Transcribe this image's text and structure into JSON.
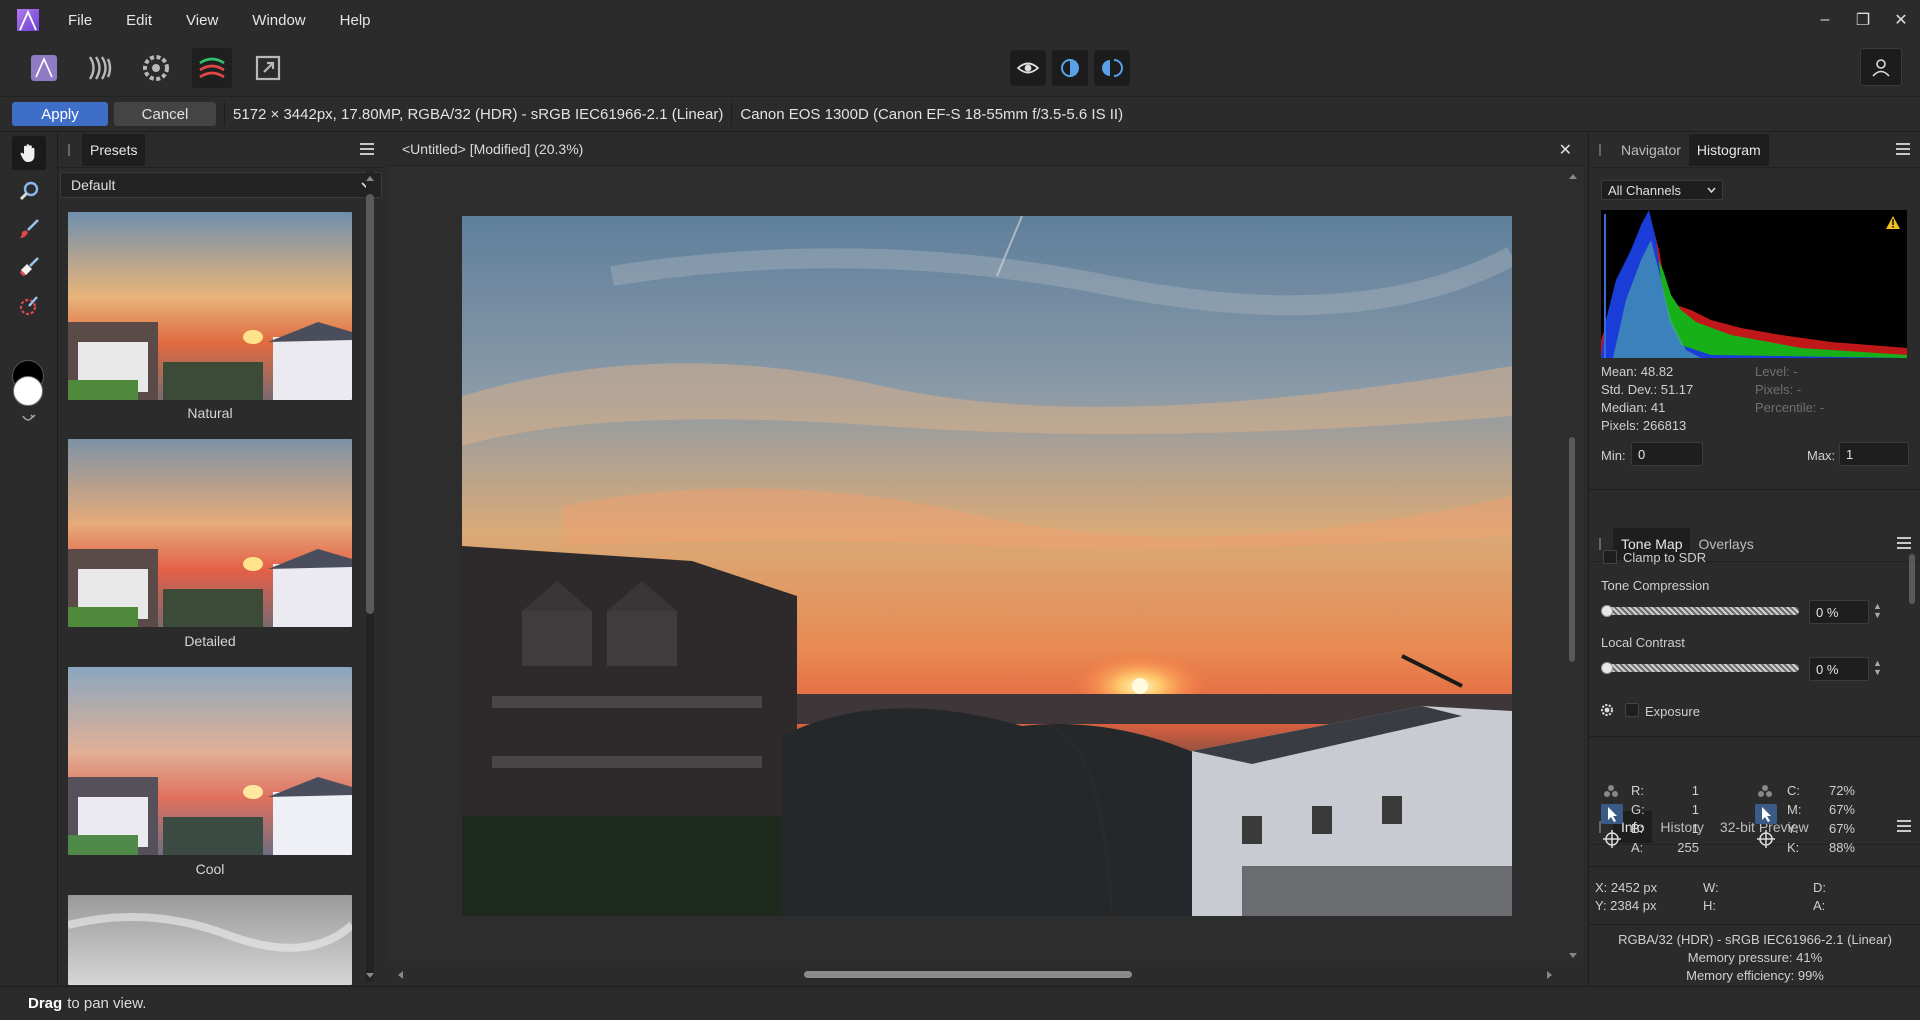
{
  "menu": {
    "items": [
      "File",
      "Edit",
      "View",
      "Window",
      "Help"
    ]
  },
  "window_controls": {
    "minimize": "–",
    "restore": "❐",
    "close": "✕"
  },
  "toolbar": {
    "personas": [
      "photo-persona",
      "liquify-persona",
      "develop-persona",
      "tone-mapping-persona",
      "export-persona"
    ],
    "active_persona": "tone-mapping-persona",
    "view_buttons": [
      "preview-icon",
      "split-view-icon",
      "mirror-view-icon"
    ]
  },
  "context_bar": {
    "apply": "Apply",
    "cancel": "Cancel",
    "image_info": "5172 × 3442px, 17.80MP, RGBA/32 (HDR) - sRGB IEC61966-2.1 (Linear)",
    "camera_info": "Canon EOS 1300D (Canon EF-S 18-55mm f/3.5-5.6 IS II)"
  },
  "presets_panel": {
    "tab": "Presets",
    "category": "Default",
    "presets": [
      "Natural",
      "Detailed",
      "Cool"
    ]
  },
  "document": {
    "title": "<Untitled> [Modified] (20.3%)"
  },
  "navigator_panel": {
    "tabs": [
      "Navigator",
      "Histogram"
    ],
    "active_tab": "Histogram",
    "channel": "All Channels",
    "stats": {
      "mean": "Mean: 48.82",
      "std_dev": "Std. Dev.: 51.17",
      "median": "Median: 41",
      "pixels": "Pixels: 266813",
      "level": "Level: -",
      "pixels_at": "Pixels: -",
      "percentile": "Percentile: -"
    },
    "min_label": "Min:",
    "min_value": "0",
    "max_label": "Max:",
    "max_value": "1"
  },
  "tonemap_panel": {
    "tabs": [
      "Tone Map",
      "Overlays"
    ],
    "active_tab": "Tone Map",
    "clamp_label": "Clamp to SDR",
    "tone_compression_label": "Tone Compression",
    "tone_compression_value": "0 %",
    "tone_compression_fraction": 0,
    "local_contrast_label": "Local Contrast",
    "local_contrast_value": "0 %",
    "local_contrast_fraction": 0,
    "exposure_label": "Exposure"
  },
  "info_panel": {
    "tabs": [
      "Info",
      "History",
      "32-bit Preview"
    ],
    "active_tab": "Info",
    "rgba": {
      "r_label": "R:",
      "r": "1",
      "g_label": "G:",
      "g": "1",
      "b_label": "B:",
      "b": "1",
      "a_label": "A:",
      "a": "255"
    },
    "cmyk": {
      "c_label": "C:",
      "c": "72%",
      "m_label": "M:",
      "m": "67%",
      "y_label": "Y:",
      "y": "67%",
      "k_label": "K:",
      "k": "88%"
    },
    "position": {
      "x": "X: 2452 px",
      "y": "Y: 2384 px",
      "w": "W:",
      "h": "H:",
      "d": "D:",
      "a": "A:"
    },
    "footer": {
      "format": "RGBA/32 (HDR) - sRGB IEC61966-2.1 (Linear)",
      "memory_pressure": "Memory pressure: 41%",
      "memory_efficiency": "Memory efficiency: 99%"
    }
  },
  "status": {
    "bold": "Drag",
    "text": "to pan view."
  },
  "colors": {
    "accent": "#3f6ec8",
    "panel_bg": "#2b2b2b",
    "dark_bg": "#1e1e1e"
  }
}
